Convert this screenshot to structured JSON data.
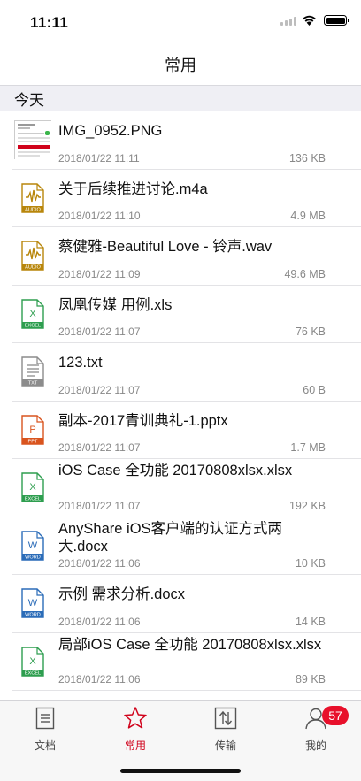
{
  "status_bar": {
    "time": "11:11",
    "battery_level": 1.0
  },
  "nav": {
    "title": "常用"
  },
  "section": {
    "title": "今天"
  },
  "files": [
    {
      "name": "IMG_0952.PNG",
      "date": "2018/01/22 11:11",
      "size": "136 KB",
      "type": "image",
      "icon": "image-thumbnail-icon"
    },
    {
      "name": "关于后续推进讨论.m4a",
      "date": "2018/01/22 11:10",
      "size": "4.9 MB",
      "type": "audio",
      "type_label": "AUDIO",
      "icon": "audio-file-icon"
    },
    {
      "name": "蔡健雅-Beautiful Love - 铃声.wav",
      "date": "2018/01/22 11:09",
      "size": "49.6 MB",
      "type": "audio",
      "type_label": "AUDIO",
      "icon": "audio-file-icon"
    },
    {
      "name": "凤凰传媒 用例.xls",
      "date": "2018/01/22 11:07",
      "size": "76 KB",
      "type": "excel",
      "type_label": "EXCEL",
      "letter": "X",
      "icon": "excel-file-icon"
    },
    {
      "name": "123.txt",
      "date": "2018/01/22 11:07",
      "size": "60 B",
      "type": "txt",
      "type_label": "TXT",
      "icon": "text-file-icon"
    },
    {
      "name": "副本-2017青训典礼-1.pptx",
      "date": "2018/01/22 11:07",
      "size": "1.7 MB",
      "type": "ppt",
      "type_label": "PPT",
      "letter": "P",
      "icon": "powerpoint-file-icon"
    },
    {
      "name": "iOS Case 全功能 20170808xlsx.xlsx",
      "date": "2018/01/22 11:07",
      "size": "192 KB",
      "type": "excel",
      "type_label": "EXCEL",
      "letter": "X",
      "icon": "excel-file-icon"
    },
    {
      "name": "AnyShare iOS客户端的认证方式两大.docx",
      "date": "2018/01/22 11:06",
      "size": "10 KB",
      "type": "word",
      "type_label": "WORD",
      "letter": "W",
      "icon": "word-file-icon"
    },
    {
      "name": "示例 需求分析.docx",
      "date": "2018/01/22 11:06",
      "size": "14 KB",
      "type": "word",
      "type_label": "WORD",
      "letter": "W",
      "icon": "word-file-icon"
    },
    {
      "name": "局部iOS Case 全功能 20170808xlsx.xlsx",
      "date": "2018/01/22 11:06",
      "size": "89 KB",
      "type": "excel",
      "type_label": "EXCEL",
      "letter": "X",
      "icon": "excel-file-icon"
    }
  ],
  "tabs": [
    {
      "label": "文档",
      "icon": "document-tab-icon",
      "active": false
    },
    {
      "label": "常用",
      "icon": "star-tab-icon",
      "active": true
    },
    {
      "label": "传输",
      "icon": "transfer-tab-icon",
      "active": false
    },
    {
      "label": "我的",
      "icon": "profile-tab-icon",
      "active": false,
      "badge": "57"
    }
  ],
  "colors": {
    "accent": "#d0021b",
    "badge": "#e8102b",
    "audio": "#b8860b",
    "excel": "#2e9e4f",
    "word": "#2b6cb8",
    "ppt": "#d9541e",
    "txt": "#8c8c8c"
  }
}
